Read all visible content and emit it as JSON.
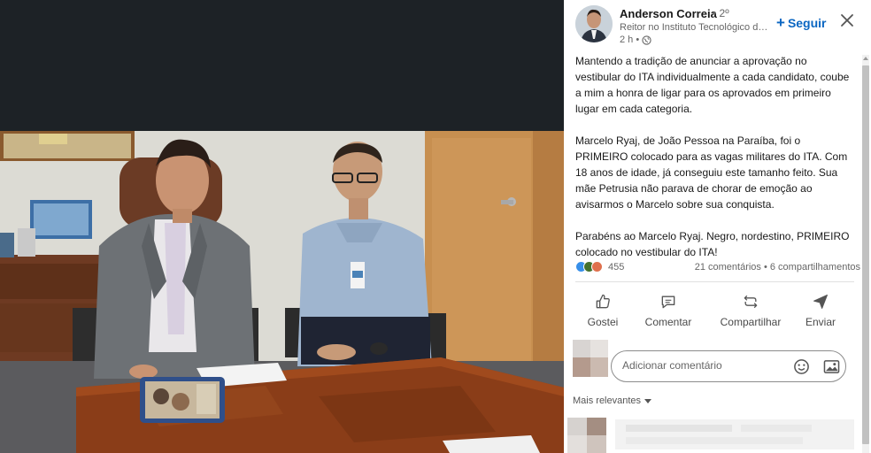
{
  "post": {
    "author_name": "Anderson Correia",
    "degree": "• 2º",
    "headline": "Reitor no Instituto Tecnológico de Aeronáutica",
    "time": "2 h •",
    "follow_label": "Seguir",
    "paragraphs": [
      "Mantendo a tradição de anunciar a aprovação no vestibular do ITA individualmente a cada candidato, coube a mim a honra de ligar para os aprovados em primeiro lugar em cada categoria.",
      "Marcelo Ryaj, de João Pessoa na Paraíba, foi o PRIMEIRO colocado para as vagas militares do ITA. Com 18 anos de idade, já conseguiu este tamanho feito. Sua mãe Petrusia não parava de chorar de emoção ao avisarmos o Marcelo sobre sua conquista.",
      "Parabéns ao Marcelo Ryaj. Negro, nordestino, PRIMEIRO colocado no vestibular do ITA!"
    ]
  },
  "social": {
    "reaction_count": "455",
    "comments_shares": "21 comentários • 6 compartilhamentos",
    "reaction_colors": [
      "#378fe9",
      "#44712e",
      "#df704d"
    ]
  },
  "actions": {
    "like": "Gostei",
    "comment": "Comentar",
    "share": "Compartilhar",
    "send": "Enviar"
  },
  "comment_input": {
    "placeholder": "Adicionar comentário"
  },
  "comments": {
    "sort_label": "Mais relevantes"
  },
  "colors": {
    "accent": "#0a66c2",
    "viewer_bg": "#1d2226"
  },
  "icons": {
    "close": "close-icon",
    "globe": "globe-icon",
    "like": "thumbs-up-icon",
    "comment": "speech-bubble-icon",
    "share": "repost-icon",
    "send": "paper-plane-icon",
    "emoji": "smiley-icon",
    "image": "image-icon"
  }
}
